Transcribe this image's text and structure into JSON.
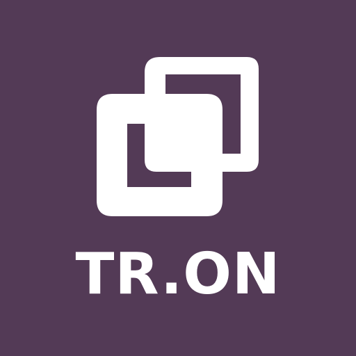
{
  "brand": {
    "name": "TR.ON",
    "background_color": "#533a56",
    "foreground_color": "#ffffff",
    "icon": "overlapping-squares-icon"
  }
}
